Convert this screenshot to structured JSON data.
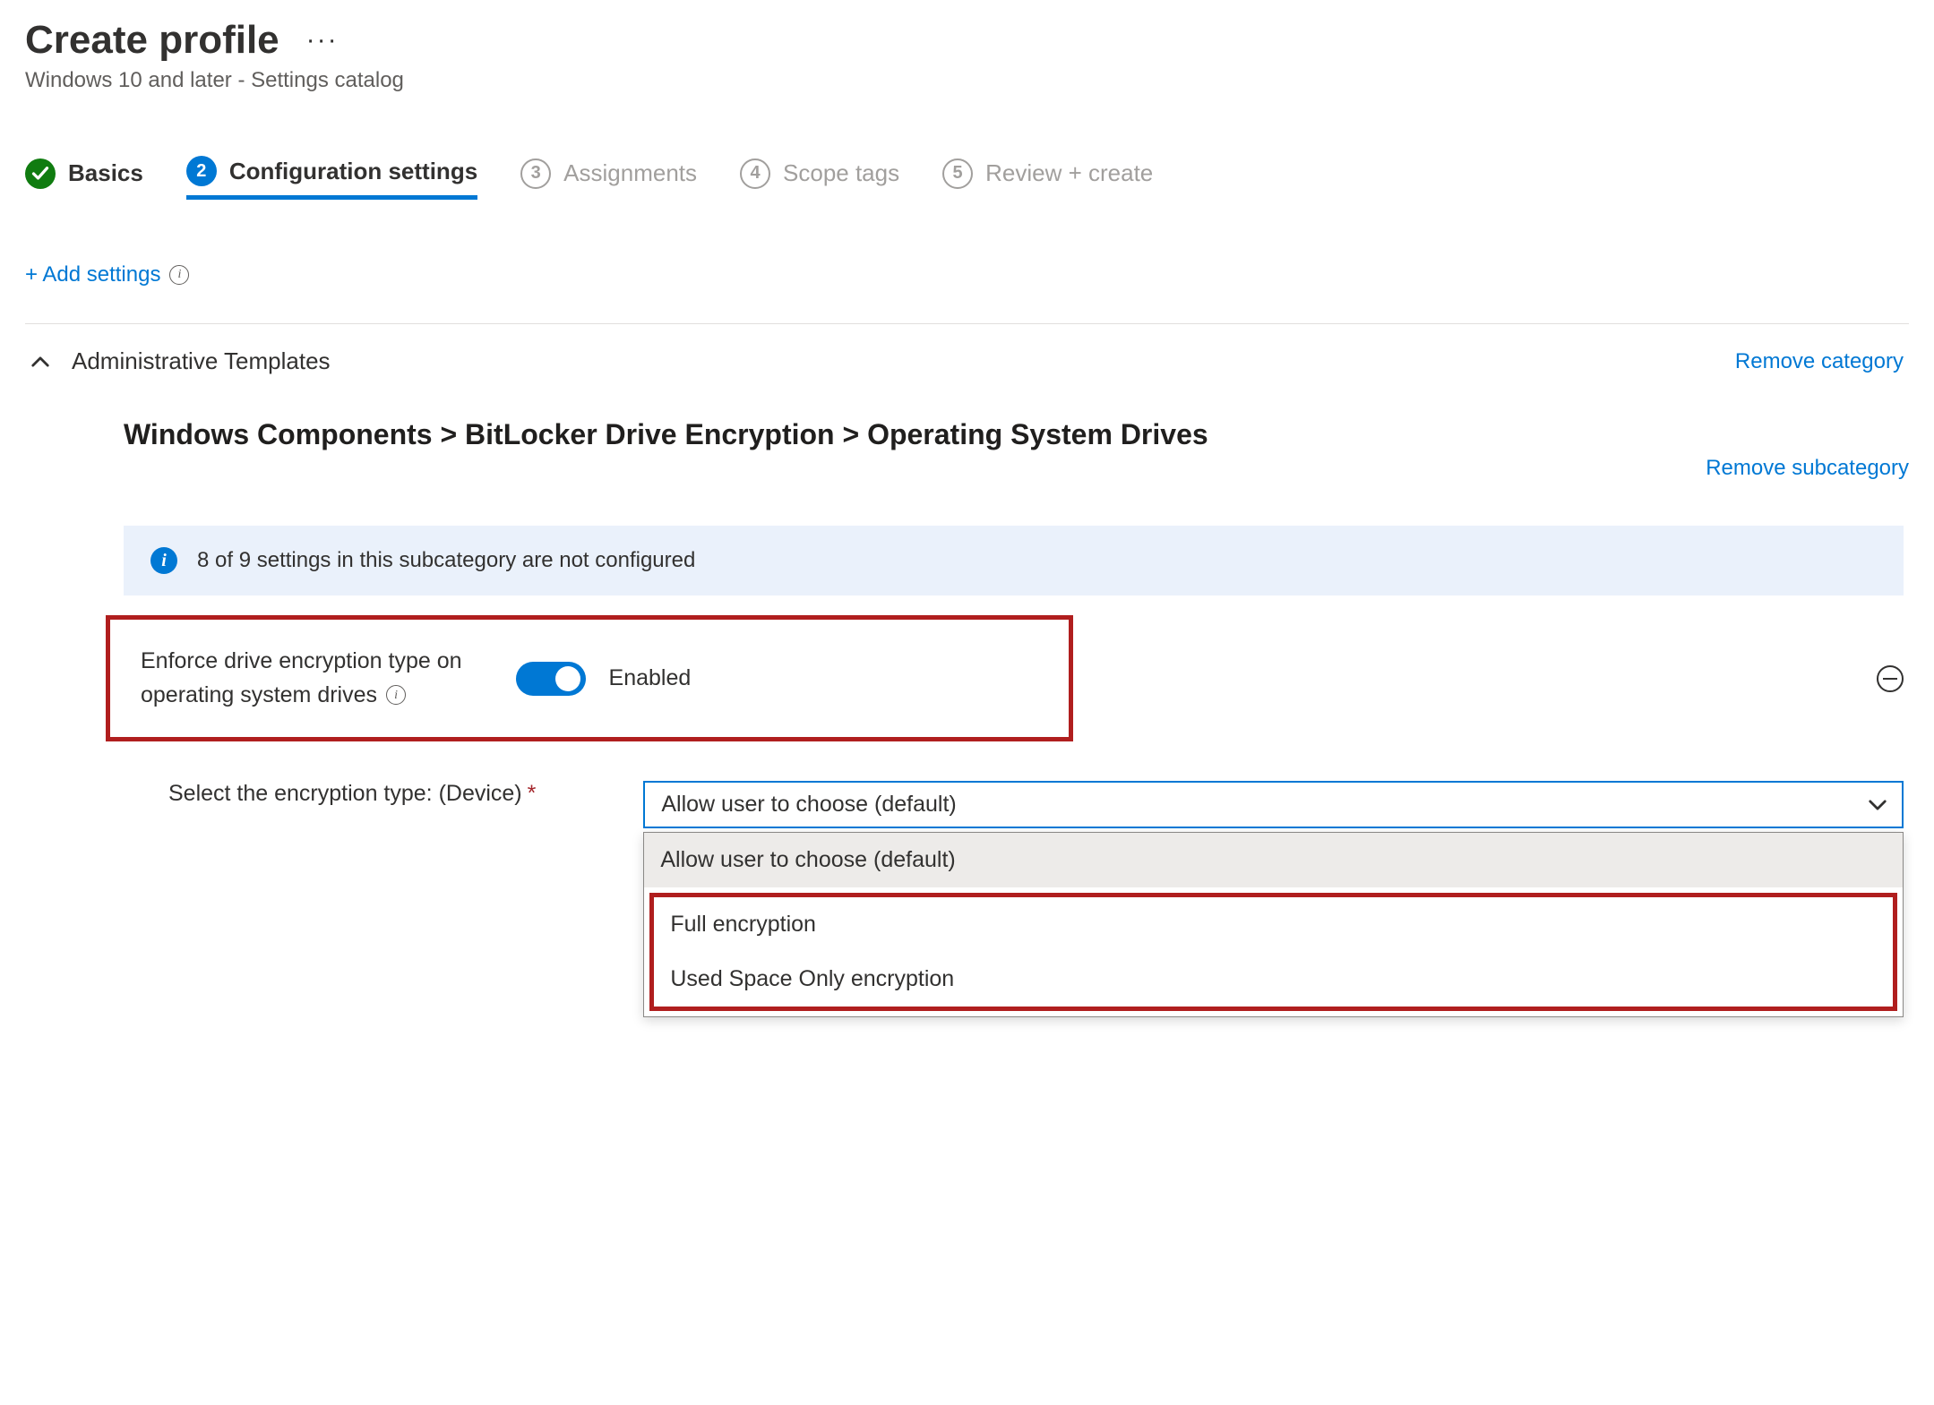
{
  "header": {
    "title": "Create profile",
    "subtitle": "Windows 10 and later - Settings catalog"
  },
  "stepper": {
    "steps": [
      {
        "num": "",
        "label": "Basics",
        "state": "done"
      },
      {
        "num": "2",
        "label": "Configuration settings",
        "state": "active"
      },
      {
        "num": "3",
        "label": "Assignments",
        "state": "pending"
      },
      {
        "num": "4",
        "label": "Scope tags",
        "state": "pending"
      },
      {
        "num": "5",
        "label": "Review + create",
        "state": "pending"
      }
    ]
  },
  "actions": {
    "add_settings": "+ Add settings"
  },
  "category": {
    "title": "Administrative Templates",
    "remove": "Remove category"
  },
  "subcategory": {
    "title": "Windows Components > BitLocker Drive Encryption > Operating System Drives",
    "remove": "Remove subcategory"
  },
  "info_banner": "8 of 9 settings in this subcategory are not configured",
  "setting": {
    "label_line1": "Enforce drive encryption type on",
    "label_line2": "operating system drives",
    "toggle_state": "Enabled"
  },
  "select": {
    "label": "Select the encryption type: (Device)",
    "value": "Allow user to choose (default)",
    "options": [
      "Allow user to choose (default)",
      "Full encryption",
      "Used Space Only encryption"
    ]
  }
}
